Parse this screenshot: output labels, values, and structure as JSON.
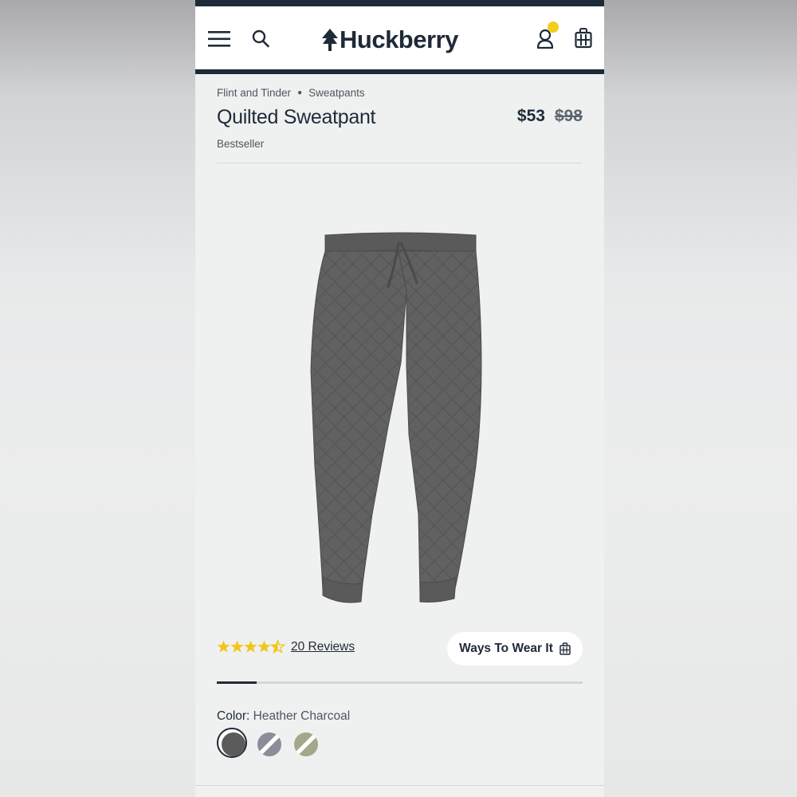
{
  "header": {
    "brand": "Huckberry",
    "icons": [
      "menu-icon",
      "search-icon",
      "account-icon",
      "cart-icon"
    ],
    "brand_color": "#1f2a38",
    "notification_color": "#f4cd1a"
  },
  "breadcrumb": {
    "brand": "Flint and Tinder",
    "category": "Sweatpants"
  },
  "product": {
    "title": "Quilted Sweatpant",
    "tag": "Bestseller",
    "price": "$53",
    "original_price": "$98",
    "rating": 4.5,
    "reviews_label": "20 Reviews",
    "ways_to_wear_label": "Ways To Wear It",
    "gallery_progress": 0.11
  },
  "color": {
    "label": "Color:",
    "selected": "Heather Charcoal",
    "swatches": [
      {
        "name": "Heather Charcoal",
        "color": "#5b5b5b",
        "available": true
      },
      {
        "name": "Heather Grey",
        "color": "#8b8e98",
        "available": false
      },
      {
        "name": "Olive",
        "color": "#a3a88c",
        "available": false
      }
    ]
  },
  "colors": {
    "accent": "#1f2a38",
    "star": "#f2c618",
    "page_bg": "#eff1f0"
  }
}
